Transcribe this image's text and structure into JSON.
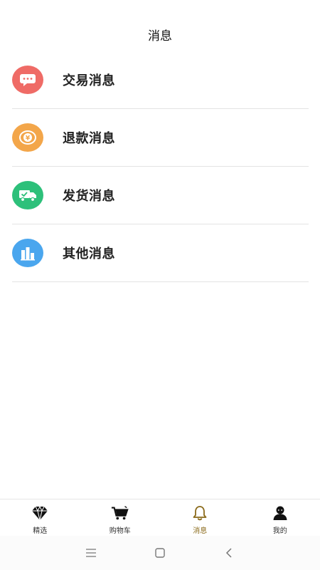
{
  "header": {
    "title": "消息"
  },
  "messages": [
    {
      "label": "交易消息",
      "icon": "chat-bubble-icon",
      "color": "#ef6b66"
    },
    {
      "label": "退款消息",
      "icon": "yen-coin-icon",
      "color": "#f3a64a"
    },
    {
      "label": "发货消息",
      "icon": "delivery-truck-icon",
      "color": "#2dc07a"
    },
    {
      "label": "其他消息",
      "icon": "bar-chart-icon",
      "color": "#4aa6ee"
    }
  ],
  "tabbar": {
    "active_color": "#8a6a1a",
    "items": [
      {
        "label": "精选",
        "icon": "diamond-icon"
      },
      {
        "label": "购物车",
        "icon": "cart-icon"
      },
      {
        "label": "消息",
        "icon": "bell-icon",
        "active": true
      },
      {
        "label": "我的",
        "icon": "user-icon"
      }
    ]
  },
  "system_nav": [
    "menu-icon",
    "home-icon",
    "back-icon"
  ]
}
